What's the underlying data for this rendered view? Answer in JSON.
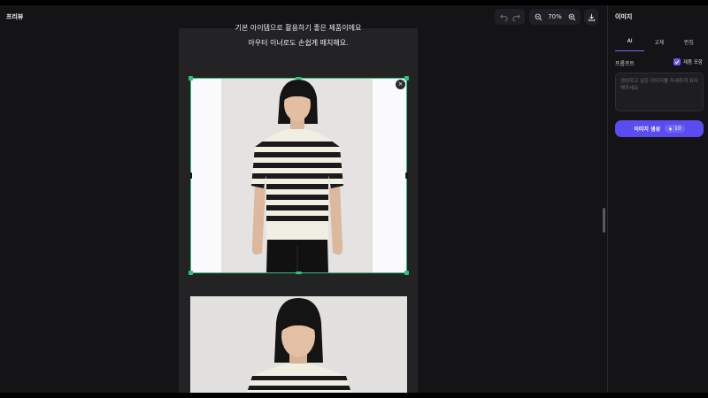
{
  "header": {
    "title": "프리뷰",
    "zoom_label": "70%",
    "undo_icon": "undo-icon",
    "redo_icon": "redo-icon",
    "zoom_out_icon": "zoom-out-icon",
    "zoom_in_icon": "zoom-in-icon",
    "download_icon": "download-icon"
  },
  "canvas": {
    "caption_line1": "기본 아이템으로 활용하기 좋은 제품이에요",
    "caption_line2": "아우터 이너로도 손쉽게 매치해요.",
    "remove_label": "×"
  },
  "panel": {
    "title": "이미지",
    "tabs": [
      "AI",
      "교체",
      "편집"
    ],
    "active_tab": "AI",
    "prompt_label": "프롬프트",
    "include_product_label": "제품 포함",
    "include_product_checked": true,
    "prompt_placeholder": "생성하고 싶은 이미지를 자세하게 묘사해주세요",
    "generate_label": "이미지 생성",
    "credit_cost": "10"
  },
  "colors": {
    "accent": "#5b4cf0",
    "selection": "#2ec27e",
    "background": "#141416"
  }
}
